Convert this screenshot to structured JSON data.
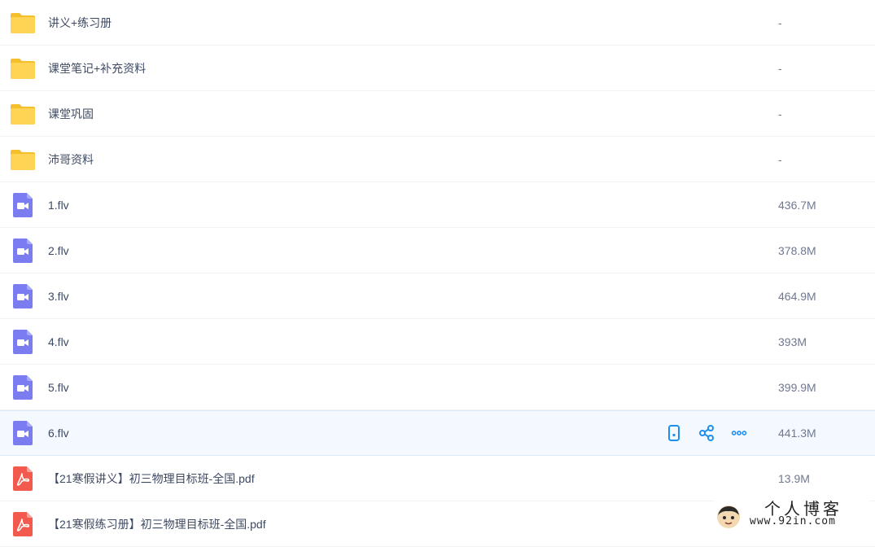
{
  "files": [
    {
      "type": "folder",
      "icon": "folder-icon",
      "name": "讲义+练习册",
      "size": "-"
    },
    {
      "type": "folder",
      "icon": "folder-icon",
      "name": "课堂笔记+补充资料",
      "size": "-"
    },
    {
      "type": "folder",
      "icon": "folder-icon",
      "name": "课堂巩固",
      "size": "-"
    },
    {
      "type": "folder",
      "icon": "folder-icon",
      "name": "沛哥资料",
      "size": "-"
    },
    {
      "type": "video",
      "icon": "video-file-icon",
      "name": "1.flv",
      "size": "436.7M"
    },
    {
      "type": "video",
      "icon": "video-file-icon",
      "name": "2.flv",
      "size": "378.8M"
    },
    {
      "type": "video",
      "icon": "video-file-icon",
      "name": "3.flv",
      "size": "464.9M"
    },
    {
      "type": "video",
      "icon": "video-file-icon",
      "name": "4.flv",
      "size": "393M"
    },
    {
      "type": "video",
      "icon": "video-file-icon",
      "name": "5.flv",
      "size": "399.9M"
    },
    {
      "type": "video",
      "icon": "video-file-icon",
      "name": "6.flv",
      "size": "441.3M",
      "hovered": true
    },
    {
      "type": "pdf",
      "icon": "pdf-file-icon",
      "name": "【21寒假讲义】初三物理目标班-全国.pdf",
      "size": "13.9M"
    },
    {
      "type": "pdf",
      "icon": "pdf-file-icon",
      "name": "【21寒假练习册】初三物理目标班-全国.pdf",
      "size": ""
    }
  ],
  "row_actions": [
    "phone-icon",
    "share-icon",
    "more-icon"
  ],
  "colors": {
    "folder": "#ffd454",
    "video": "#7b7cf0",
    "pdf": "#f25a4e",
    "action": "#1e8ff0",
    "hover_bg": "#f4f9ff"
  },
  "watermark": {
    "title": "个人博客",
    "url": "www.92in.com"
  }
}
